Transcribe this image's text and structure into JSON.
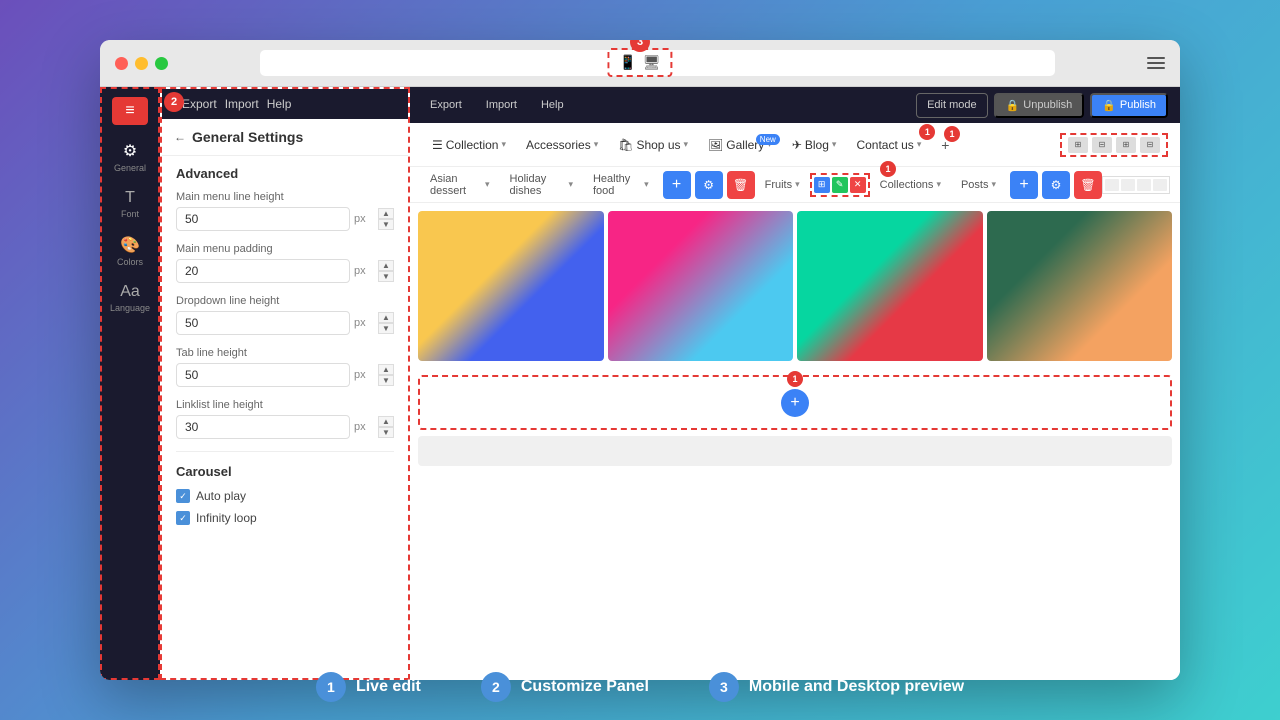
{
  "browser": {
    "traffic_lights": [
      "red",
      "yellow",
      "green"
    ],
    "badge3_label": "3"
  },
  "toolbar": {
    "export_label": "Export",
    "import_label": "Import",
    "help_label": "Help",
    "edit_mode_label": "Edit mode",
    "unpublish_label": "Unpublish",
    "publish_label": "Publish"
  },
  "panel": {
    "title": "General Settings",
    "badge2_label": "2",
    "section_advanced": "Advanced",
    "fields": [
      {
        "label": "Main menu line height",
        "value": "50",
        "unit": "px"
      },
      {
        "label": "Main menu padding",
        "value": "20",
        "unit": "px"
      },
      {
        "label": "Dropdown line height",
        "value": "50",
        "unit": "px"
      },
      {
        "label": "Tab line height",
        "value": "50",
        "unit": "px"
      },
      {
        "label": "Linklist line height",
        "value": "30",
        "unit": "px"
      }
    ],
    "carousel_title": "Carousel",
    "checkboxes": [
      {
        "label": "Auto play",
        "checked": true
      },
      {
        "label": "Infinity loop",
        "checked": true
      }
    ]
  },
  "sidebar_icons": [
    {
      "icon": "⚙",
      "label": "General"
    },
    {
      "icon": "T",
      "label": "Font"
    },
    {
      "icon": "🎨",
      "label": "Colors"
    },
    {
      "icon": "A",
      "label": "Language"
    }
  ],
  "nav": {
    "items": [
      {
        "label": "Collection",
        "icon": "☰",
        "has_dropdown": true
      },
      {
        "label": "Accessories",
        "has_dropdown": true
      },
      {
        "label": "Shop us",
        "has_dropdown": true,
        "icon": "🛍"
      },
      {
        "label": "Gallery",
        "has_dropdown": true,
        "is_new": true,
        "icon": "🖼"
      },
      {
        "label": "Blog",
        "has_dropdown": true,
        "icon": "✈"
      },
      {
        "label": "Contact us",
        "has_dropdown": true
      }
    ],
    "badge1_label": "1"
  },
  "sub_nav": {
    "items": [
      {
        "label": "Asian dessert",
        "has_dropdown": true
      },
      {
        "label": "Holiday dishes",
        "has_dropdown": true
      },
      {
        "label": "Healthy food",
        "has_dropdown": true
      },
      {
        "label": "Fruits",
        "has_dropdown": true
      },
      {
        "label": "Collections",
        "has_dropdown": true
      },
      {
        "label": "Posts",
        "has_dropdown": true
      }
    ]
  },
  "bottom_labels": [
    {
      "num": "1",
      "text": "Live edit"
    },
    {
      "num": "2",
      "text": "Customize Panel"
    },
    {
      "num": "3",
      "text": "Mobile and Desktop preview"
    }
  ]
}
